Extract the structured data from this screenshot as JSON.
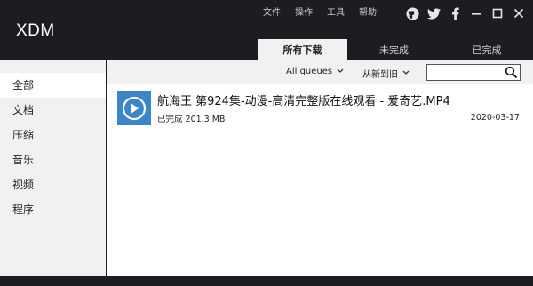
{
  "app": {
    "title": "XDM"
  },
  "menu": {
    "items": [
      "文件",
      "操作",
      "工具",
      "帮助"
    ]
  },
  "window_icons": [
    "github-icon",
    "twitter-icon",
    "facebook-icon",
    "minimize-icon",
    "maximize-icon",
    "close-icon"
  ],
  "tabs": [
    {
      "label": "所有下载",
      "active": true
    },
    {
      "label": "未完成",
      "active": false
    },
    {
      "label": "已完成",
      "active": false
    }
  ],
  "sidebar": {
    "items": [
      {
        "label": "全部",
        "active": true
      },
      {
        "label": "文档",
        "active": false
      },
      {
        "label": "压缩",
        "active": false
      },
      {
        "label": "音乐",
        "active": false
      },
      {
        "label": "视频",
        "active": false
      },
      {
        "label": "程序",
        "active": false
      }
    ]
  },
  "toolbar": {
    "queue_filter": "All queues",
    "sort_order": "从新到旧",
    "search_value": "",
    "search_placeholder": ""
  },
  "downloads": [
    {
      "name": "航海王 第924集-动漫-高清完整版在线观看 - 爱奇艺.MP4",
      "status": "已完成 201.3 MB",
      "date": "2020-03-17",
      "icon": "play-video-icon"
    }
  ],
  "colors": {
    "chrome_bg": "#1b1d20",
    "panel_bg": "#f1f1f1",
    "thumb_blue": "#3a86c8"
  }
}
